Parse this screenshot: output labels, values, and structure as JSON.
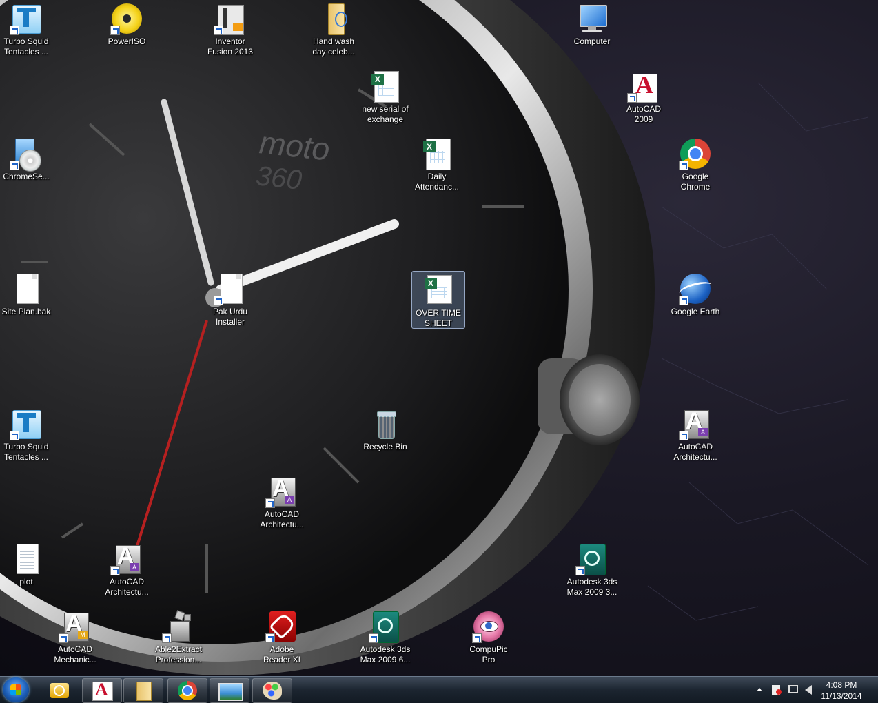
{
  "desktop": {
    "wallpaper_text": {
      "brand": "moto",
      "model": "360"
    },
    "icons": [
      {
        "label": "Turbo Squid\nTentacles ...",
        "icon": "turbosquid-icon"
      },
      {
        "label": "PowerISO",
        "icon": "poweriso-icon"
      },
      {
        "label": "Inventor\nFusion 2013",
        "icon": "inventor-fusion-icon"
      },
      {
        "label": "Hand wash\nday celeb...",
        "icon": "folder-icon"
      },
      {
        "label": "Computer",
        "icon": "computer-icon"
      },
      {
        "label": "new serial of\nexchange",
        "icon": "excel-file-icon"
      },
      {
        "label": "AutoCAD\n2009",
        "icon": "autocad-icon"
      },
      {
        "label": "ChromeSe...",
        "icon": "installer-icon"
      },
      {
        "label": "Daily\nAttendanc...",
        "icon": "excel-file-icon"
      },
      {
        "label": "Google\nChrome",
        "icon": "chrome-icon"
      },
      {
        "label": "Site Plan.bak",
        "icon": "blank-file-icon"
      },
      {
        "label": "Pak Urdu\nInstaller",
        "icon": "blank-file-icon"
      },
      {
        "label": "OVER TIME\nSHEET",
        "icon": "excel-file-icon"
      },
      {
        "label": "Google Earth",
        "icon": "google-earth-icon"
      },
      {
        "label": "Turbo Squid\nTentacles ...",
        "icon": "turbosquid-icon"
      },
      {
        "label": "Recycle Bin",
        "icon": "recycle-bin-icon"
      },
      {
        "label": "AutoCAD\nArchitectu...",
        "icon": "autocad-architecture-icon"
      },
      {
        "label": "AutoCAD\nArchitectu...",
        "icon": "autocad-architecture-icon"
      },
      {
        "label": "plot",
        "icon": "text-file-icon"
      },
      {
        "label": "AutoCAD\nArchitectu...",
        "icon": "autocad-architecture-icon"
      },
      {
        "label": "Autodesk 3ds\nMax 2009 3...",
        "icon": "3dsmax-icon"
      },
      {
        "label": "AutoCAD\nMechanic...",
        "icon": "autocad-mechanical-icon"
      },
      {
        "label": "Able2Extract\nProfession...",
        "icon": "able2extract-icon"
      },
      {
        "label": "Adobe\nReader XI",
        "icon": "adobe-reader-icon"
      },
      {
        "label": "Autodesk 3ds\nMax 2009 6...",
        "icon": "3dsmax-icon"
      },
      {
        "label": "CompuPic\nPro",
        "icon": "compupic-icon"
      }
    ]
  },
  "taskbar": {
    "start_icon": "windows-start-icon",
    "pinned": [
      {
        "name": "outlook",
        "icon": "outlook-icon"
      },
      {
        "name": "autocad",
        "icon": "autocad-icon"
      },
      {
        "name": "explorer",
        "icon": "folder-icon"
      },
      {
        "name": "chrome",
        "icon": "chrome-icon"
      },
      {
        "name": "photo-viewer",
        "icon": "photo-viewer-icon"
      },
      {
        "name": "paint",
        "icon": "paint-icon"
      }
    ],
    "tray": {
      "icons": [
        "show-hidden-icons-icon",
        "action-center-icon",
        "network-icon",
        "volume-icon"
      ],
      "time": "4:08 PM",
      "date": "11/13/2014"
    }
  },
  "colors": {
    "excel_green": "#1e7145",
    "autocad_red": "#c8102e",
    "chrome_red": "#db4437",
    "chrome_yellow": "#f4b400",
    "chrome_green": "#0f9d58",
    "chrome_blue": "#4285f4"
  }
}
